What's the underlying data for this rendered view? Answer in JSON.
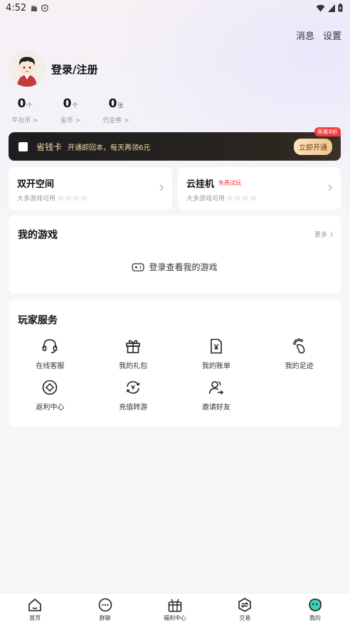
{
  "status_bar": {
    "time": "4:52"
  },
  "header": {
    "messages_label": "消息",
    "settings_label": "设置"
  },
  "profile": {
    "login_text": "登录/注册"
  },
  "stats": [
    {
      "value": "0",
      "unit": "个",
      "label": "平台币 >"
    },
    {
      "value": "0",
      "unit": "个",
      "label": "金币 >"
    },
    {
      "value": "0",
      "unit": "张",
      "label": "代金券 >"
    }
  ],
  "savings_card": {
    "title": "省钱卡",
    "description": "开通即回本，每天再领6元",
    "button_label": "立即开通",
    "badge": "新客8折"
  },
  "dual_space": {
    "title": "双开空间",
    "subtitle": "大多游戏可用"
  },
  "cloud_hangup": {
    "title": "云挂机",
    "tag": "免费试玩",
    "subtitle": "大多游戏可用"
  },
  "my_games": {
    "title": "我的游戏",
    "more_label": "更多",
    "empty_text": "登录查看我的游戏"
  },
  "player_services": {
    "title": "玩家服务",
    "items": [
      {
        "label": "在线客服",
        "icon": "headset-icon"
      },
      {
        "label": "我的礼包",
        "icon": "gift-icon"
      },
      {
        "label": "我的账单",
        "icon": "bill-icon"
      },
      {
        "label": "我的足迹",
        "icon": "footprint-icon"
      },
      {
        "label": "返利中心",
        "icon": "rebate-icon"
      },
      {
        "label": "充值转游",
        "icon": "recharge-transfer-icon"
      },
      {
        "label": "邀请好友",
        "icon": "invite-friends-icon"
      }
    ]
  },
  "tabbar": {
    "items": [
      {
        "label": "首页",
        "icon": "home-icon"
      },
      {
        "label": "群聊",
        "icon": "chat-icon"
      },
      {
        "label": "福利中心",
        "icon": "gift-box-icon"
      },
      {
        "label": "交易",
        "icon": "trade-icon"
      },
      {
        "label": "我的",
        "icon": "profile-icon",
        "active": true
      }
    ]
  }
}
